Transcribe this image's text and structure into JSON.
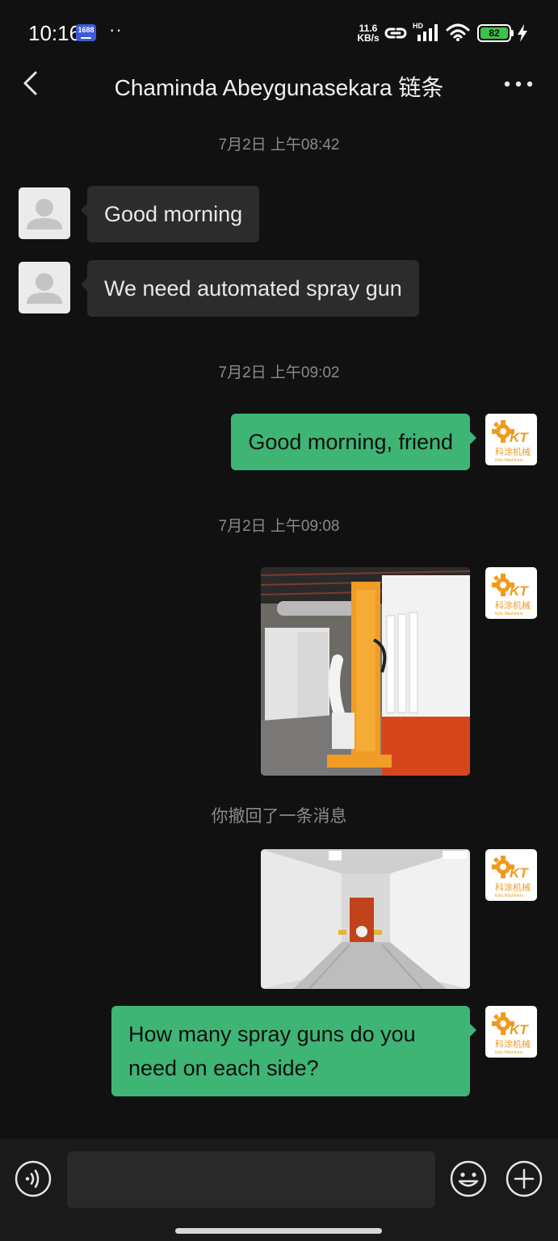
{
  "status_bar": {
    "time": "10:16",
    "app_badge": "1688",
    "dots": "··",
    "net_speed_value": "11.6",
    "net_speed_unit": "KB/s",
    "signal_label": "HD",
    "battery_level": "82"
  },
  "header": {
    "title": "Chaminda Abeygunasekara 链条",
    "back_icon": "chevron-left-icon",
    "more_icon": "more-horizontal-icon"
  },
  "avatar_logo": {
    "letters": "KT",
    "name_cn": "科涂机械",
    "name_en": "Ketu Machinery",
    "color": "#f29a1c"
  },
  "messages": {
    "ts1": "7月2日 上午08:42",
    "m1": "Good morning",
    "m2": "We need automated spray gun",
    "ts2": "7月2日 上午09:02",
    "m3": "Good morning, friend",
    "ts3": "7月2日 上午09:08",
    "recalled": "你撤回了一条消息",
    "m6": "How many spray guns do you need on each side?"
  },
  "input_bar": {
    "placeholder": "",
    "voice_icon": "voice-icon",
    "emoji_icon": "emoji-icon",
    "plus_icon": "plus-circle-icon"
  },
  "colors": {
    "background": "#111111",
    "incoming_bubble": "#2c2c2c",
    "outgoing_bubble": "#3eb575"
  }
}
